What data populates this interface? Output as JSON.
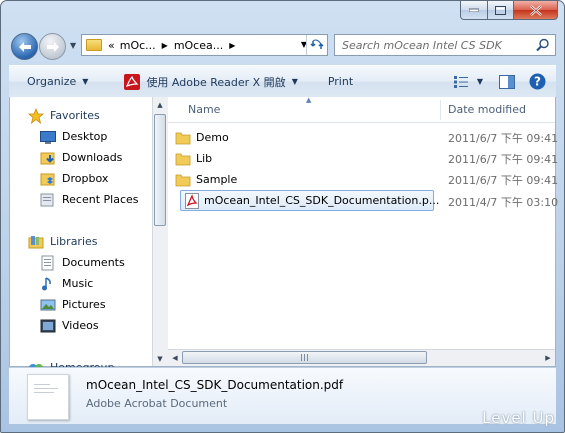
{
  "window": {
    "caption_buttons": [
      "minimize",
      "maximize",
      "close"
    ]
  },
  "address": {
    "overflow": "«",
    "crumbs": [
      "mOc...",
      "mOcea..."
    ],
    "search_placeholder": "Search mOcean Intel CS SDK"
  },
  "toolbar": {
    "organize": "Organize",
    "open_with": "使用 Adobe Reader X 開啟",
    "print": "Print"
  },
  "nav": {
    "favorites": "Favorites",
    "favorites_items": [
      "Desktop",
      "Downloads",
      "Dropbox",
      "Recent Places"
    ],
    "libraries": "Libraries",
    "libraries_items": [
      "Documents",
      "Music",
      "Pictures",
      "Videos"
    ],
    "homegroup": "Homegroup"
  },
  "columns": {
    "name": "Name",
    "date_modified": "Date modified"
  },
  "files": [
    {
      "name": "Demo",
      "type": "folder",
      "date": "2011/6/7 下午 09:41"
    },
    {
      "name": "Lib",
      "type": "folder",
      "date": "2011/6/7 下午 09:41"
    },
    {
      "name": "Sample",
      "type": "folder",
      "date": "2011/6/7 下午 09:41"
    },
    {
      "name": "mOcean_Intel_CS_SDK_Documentation.p...",
      "type": "pdf",
      "date": "2011/4/7 下午 03:10",
      "selected": true
    }
  ],
  "details": {
    "file_name": "mOcean_Intel_CS_SDK_Documentation.pdf",
    "file_type": "Adobe Acrobat Document"
  },
  "watermark": "Level Up",
  "colors": {
    "frame": "#bcd2ea",
    "selection": "#deebfa",
    "text_accent": "#1e395b"
  }
}
